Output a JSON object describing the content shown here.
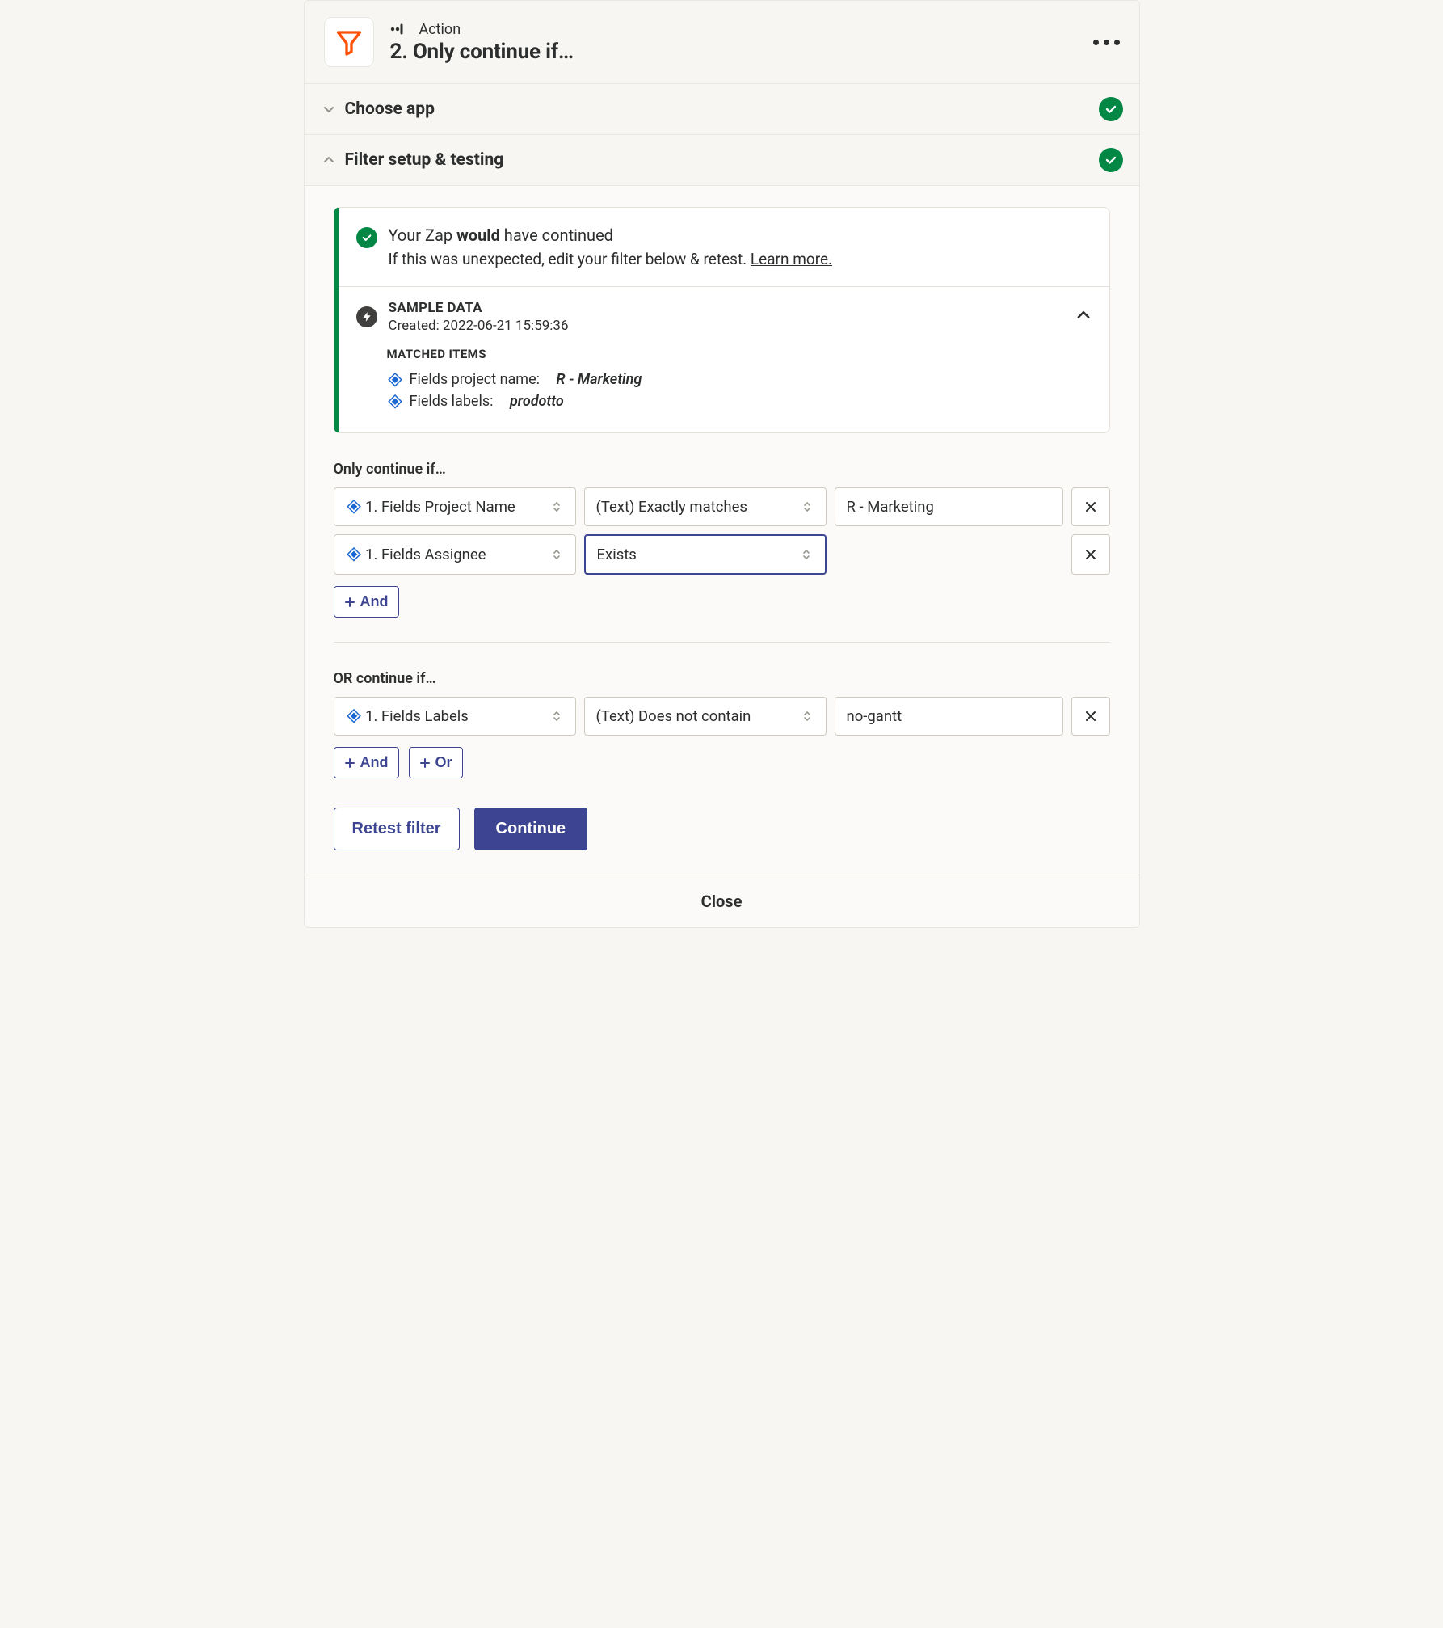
{
  "header": {
    "kicker": "Action",
    "title": "2. Only continue if…"
  },
  "sections": {
    "chooseApp": "Choose app",
    "filterSetup": "Filter setup & testing"
  },
  "result": {
    "title_prefix": "Your Zap ",
    "title_bold": "would",
    "title_suffix": " have continued",
    "subtext": "If this was unexpected, edit your filter below & retest. ",
    "learn_more": "Learn more."
  },
  "sample": {
    "label": "SAMPLE DATA",
    "created": "Created: 2022-06-21 15:59:36",
    "matched_title": "MATCHED ITEMS",
    "items": [
      {
        "label": "Fields project name:",
        "value": "R - Marketing"
      },
      {
        "label": "Fields labels:",
        "value": "prodotto"
      }
    ]
  },
  "filter": {
    "group1_label": "Only continue if…",
    "group2_label": "OR continue if…",
    "rules1": [
      {
        "field": "1. Fields Project Name",
        "condition": "(Text) Exactly matches",
        "value": "R - Marketing",
        "cond_selected": false
      },
      {
        "field": "1. Fields Assignee",
        "condition": "Exists",
        "value": "",
        "cond_selected": true
      }
    ],
    "rules2": [
      {
        "field": "1. Fields Labels",
        "condition": "(Text) Does not contain",
        "value": "no-gantt",
        "cond_selected": false
      }
    ],
    "and_label": "And",
    "or_label": "Or"
  },
  "actions": {
    "retest": "Retest filter",
    "continue": "Continue"
  },
  "footer": {
    "close": "Close"
  }
}
